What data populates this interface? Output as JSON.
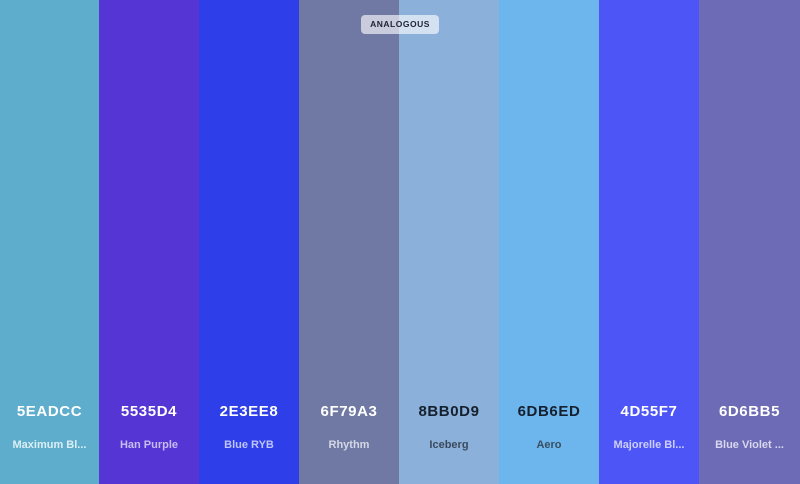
{
  "badge": {
    "label": "ANALOGOUS"
  },
  "swatches": [
    {
      "hex": "5EADCC",
      "name": "Maximum Bl...",
      "color": "#5EADCC",
      "hex_color": "#FFFFFF",
      "name_color": "#DCEEF5"
    },
    {
      "hex": "5535D4",
      "name": "Han Purple",
      "color": "#5535D4",
      "hex_color": "#FFFFFF",
      "name_color": "#C6BDF0"
    },
    {
      "hex": "2E3EE8",
      "name": "Blue RYB",
      "color": "#2E3EE8",
      "hex_color": "#FFFFFF",
      "name_color": "#BFC5F8"
    },
    {
      "hex": "6F79A3",
      "name": "Rhythm",
      "color": "#6F79A3",
      "hex_color": "#FFFFFF",
      "name_color": "#D4D8E6"
    },
    {
      "hex": "8BB0D9",
      "name": "Iceberg",
      "color": "#8BB0D9",
      "hex_color": "#15202E",
      "name_color": "#3B4A5E"
    },
    {
      "hex": "6DB6ED",
      "name": "Aero",
      "color": "#6DB6ED",
      "hex_color": "#15202E",
      "name_color": "#3A4E62"
    },
    {
      "hex": "4D55F7",
      "name": "Majorelle Bl...",
      "color": "#4D55F7",
      "hex_color": "#FFFFFF",
      "name_color": "#CDD0FC"
    },
    {
      "hex": "6D6BB5",
      "name": "Blue Violet ...",
      "color": "#6D6BB5",
      "hex_color": "#FFFFFF",
      "name_color": "#D8D7EE"
    }
  ]
}
